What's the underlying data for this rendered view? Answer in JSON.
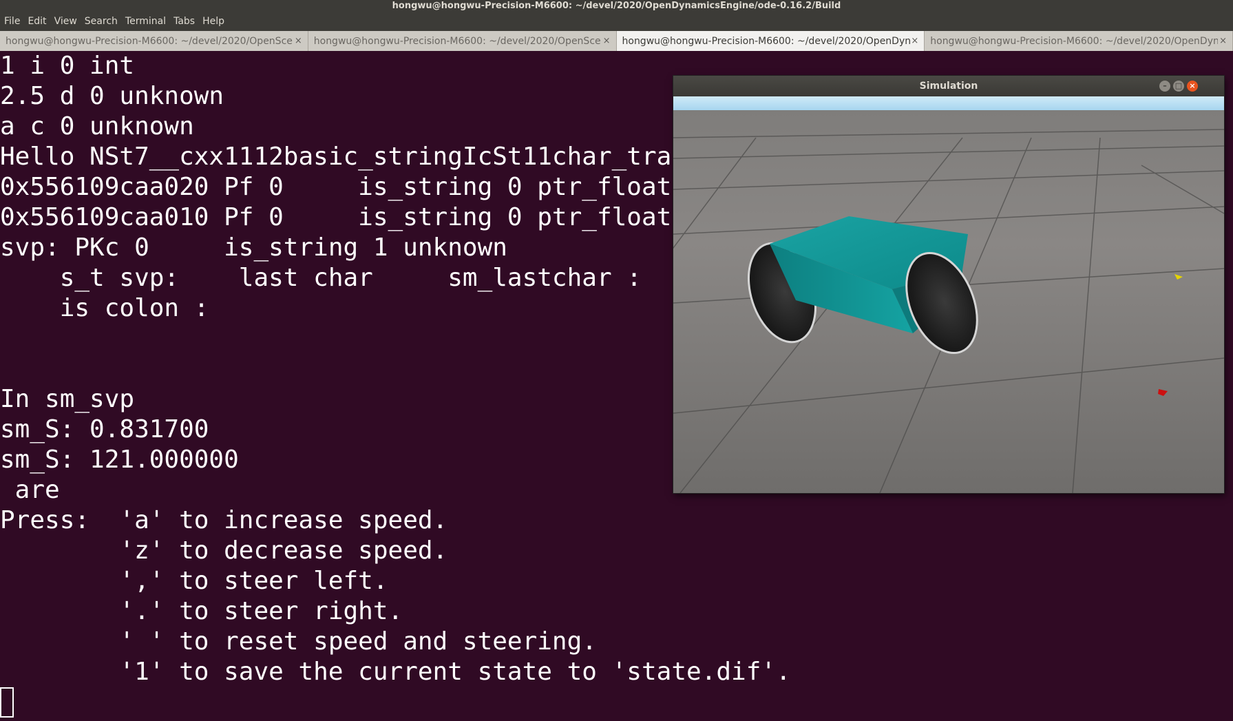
{
  "window": {
    "title": "hongwu@hongwu-Precision-M6600: ~/devel/2020/OpenDynamicsEngine/ode-0.16.2/Build"
  },
  "menu": [
    "File",
    "Edit",
    "View",
    "Search",
    "Terminal",
    "Tabs",
    "Help"
  ],
  "tabs": [
    {
      "label": "hongwu@hongwu-Precision-M6600: ~/devel/2020/OpenSce...",
      "close": "×"
    },
    {
      "label": "hongwu@hongwu-Precision-M6600: ~/devel/2020/OpenSce...",
      "close": "×"
    },
    {
      "label": "hongwu@hongwu-Precision-M6600: ~/devel/2020/OpenDyn...",
      "close": "×"
    },
    {
      "label": "hongwu@hongwu-Precision-M6600: ~/devel/2020/OpenDyn...",
      "close": "×"
    }
  ],
  "terminal": {
    "lines": [
      "1 i 0 int",
      "2.5 d 0 unknown",
      "a c 0 unknown",
      "Hello NSt7__cxx1112basic_stringIcSt11char_tra",
      "0x556109caa020 Pf 0     is_string 0 ptr_float",
      "0x556109caa010 Pf 0     is_string 0 ptr_float",
      "svp: PKc 0     is_string 1 unknown",
      "    s_t svp:    last char     sm_lastchar :",
      "    is colon :",
      "",
      "",
      "In sm_svp",
      "sm_S: 0.831700",
      "sm_S: 121.000000",
      " are",
      "Press:  'a' to increase speed.",
      "        'z' to decrease speed.",
      "        ',' to steer left.",
      "        '.' to steer right.",
      "        ' ' to reset speed and steering.",
      "        '1' to save the current state to 'state.dif'."
    ]
  },
  "simulation": {
    "title": "Simulation",
    "minimize": "–",
    "maximize": "□",
    "close": "×"
  }
}
